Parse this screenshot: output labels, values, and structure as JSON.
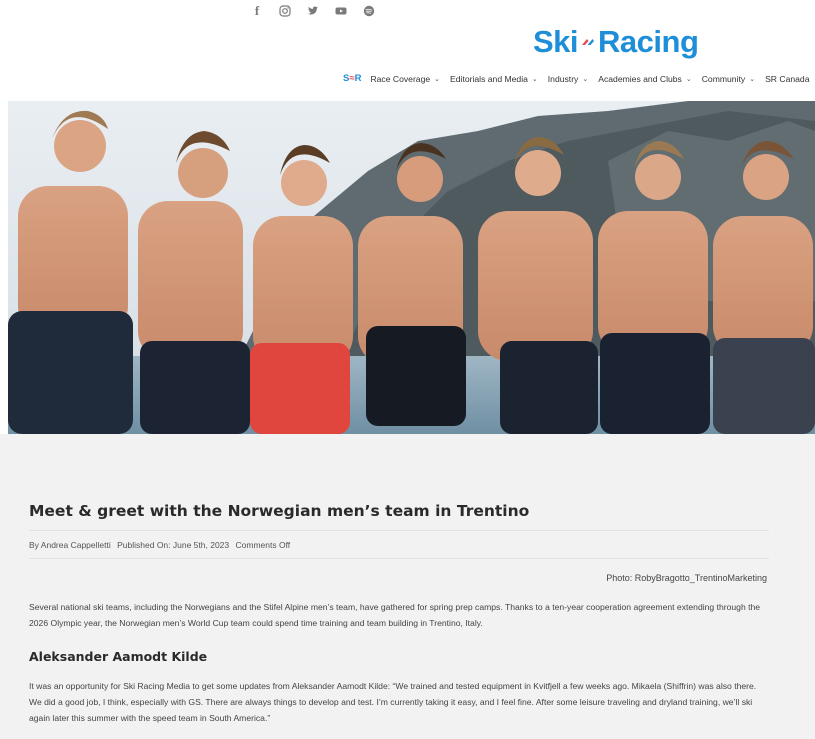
{
  "header": {
    "social": [
      {
        "name": "facebook-icon",
        "glyph": "f"
      },
      {
        "name": "instagram-icon",
        "glyph": ""
      },
      {
        "name": "twitter-icon",
        "glyph": ""
      },
      {
        "name": "youtube-icon",
        "glyph": ""
      },
      {
        "name": "spotify-icon",
        "glyph": ""
      }
    ],
    "logo_left": "Ski",
    "logo_right": "Racing",
    "nav_brand_a": "S",
    "nav_brand_b": "≈",
    "nav_brand_c": "R",
    "nav": [
      {
        "label": "Race Coverage"
      },
      {
        "label": "Editorials and Media"
      },
      {
        "label": "Industry"
      },
      {
        "label": "Academies and Clubs"
      },
      {
        "label": "Community"
      },
      {
        "label": "SR Canada"
      }
    ]
  },
  "article": {
    "title": "Meet & greet with the Norwegian men’s team in Trentino",
    "author": "By Andrea Cappelletti",
    "published": "Published On: June 5th, 2023",
    "comments": "Comments Off",
    "photo_credit": "Photo: RobyBragotto_TrentinoMarketing",
    "intro": "Several national ski teams, including the Norwegians and the Stifel Alpine men’s team, have gathered for spring prep camps. Thanks to a ten-year cooperation agreement extending through the 2026 Olympic year, the Norwegian men’s World Cup team could spend time training and team building in Trentino, Italy.",
    "subhead": "Aleksander Aamodt Kilde",
    "body": "It was an opportunity for Ski Racing Media to get some updates from Aleksander Aamodt Kilde: “We trained and tested equipment in Kvitfjell a few weeks ago. Mikaela (Shiffrin) was also there. We did a good job, I think, especially with GS. There are always things to develop and test. I’m currently taking it easy, and I feel fine. After some leisure traveling and dryland training, we’ll ski again later this summer with the speed team in South America.”"
  },
  "colors": {
    "brand_blue": "#1e8ed8",
    "brand_red": "#e5484d",
    "article_bg": "#f2f2f3"
  }
}
